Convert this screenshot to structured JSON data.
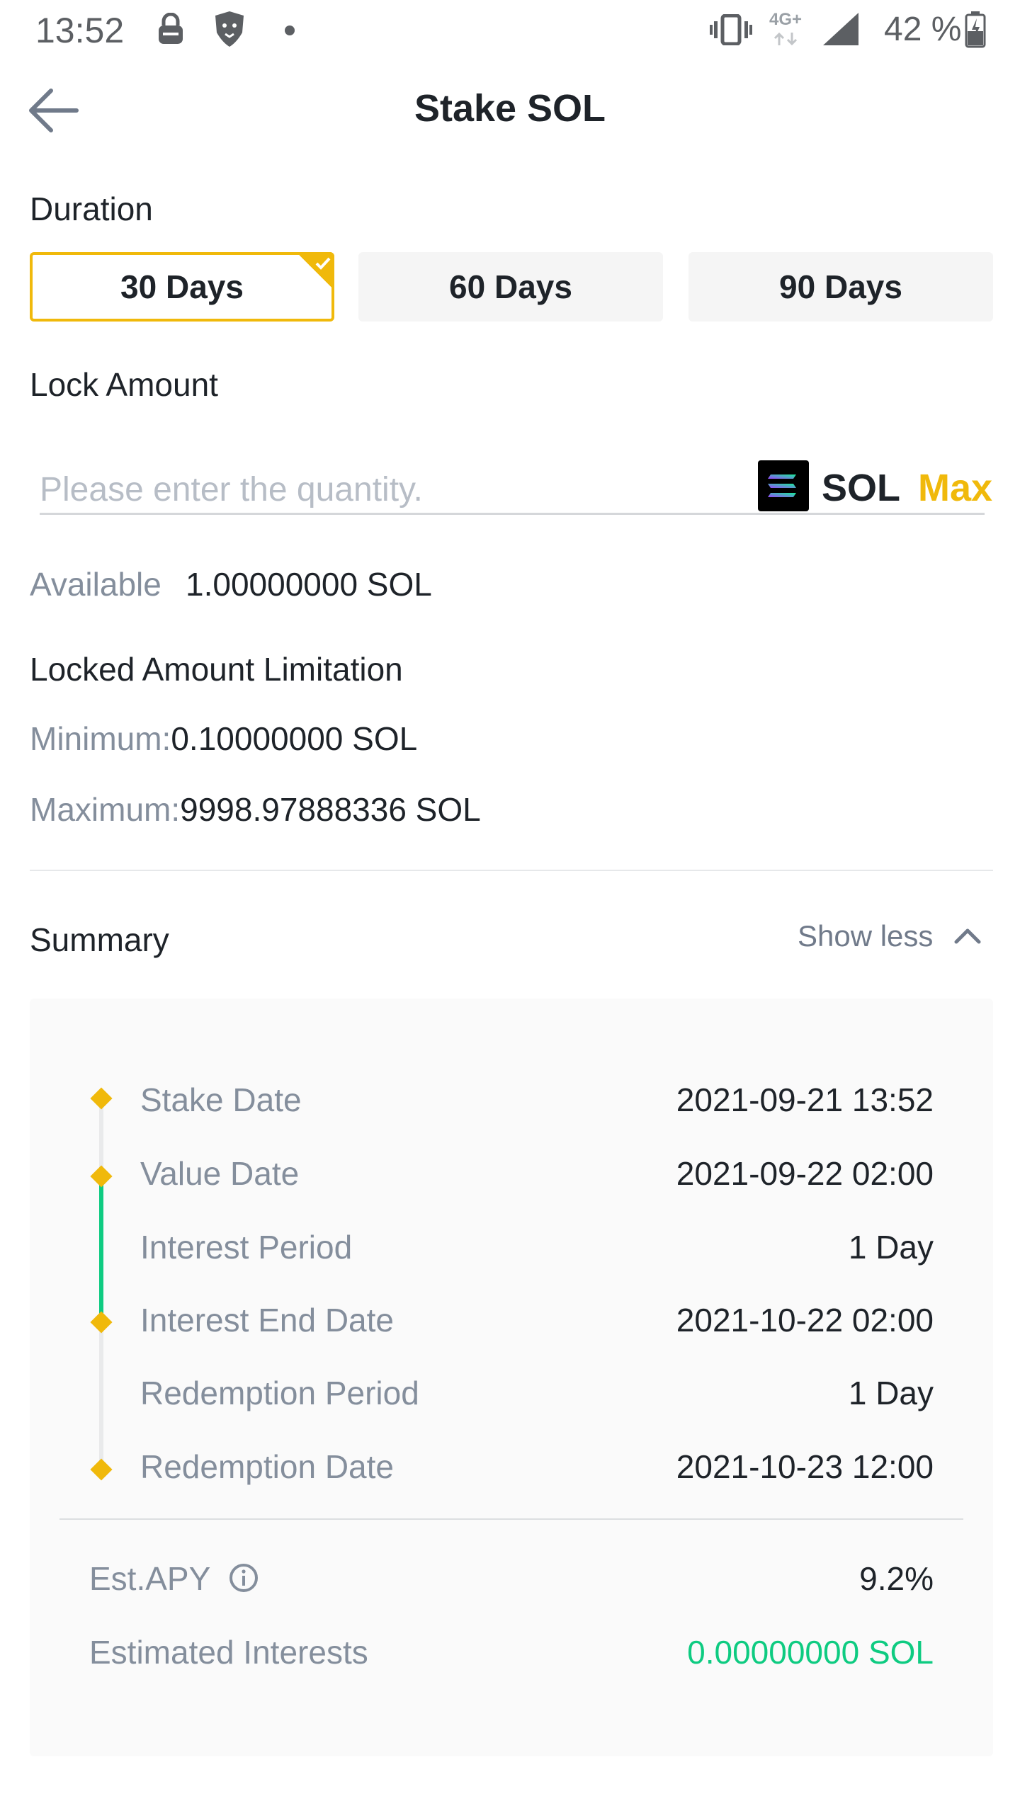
{
  "status_bar": {
    "time": "13:52",
    "network": "4G+",
    "battery": "42 %",
    "icons": [
      "lock-icon",
      "brave-lion-icon",
      "dot-icon",
      "vibrate-icon",
      "signal-icon",
      "battery-icon"
    ]
  },
  "header": {
    "title": "Stake SOL",
    "back_icon": "arrow-left-icon"
  },
  "duration": {
    "label": "Duration",
    "options": [
      {
        "label": "30 Days",
        "selected": true
      },
      {
        "label": "60 Days",
        "selected": false
      },
      {
        "label": "90 Days",
        "selected": false
      }
    ]
  },
  "lock_amount": {
    "label": "Lock Amount",
    "input_placeholder": "Please enter the quantity.",
    "input_value": "",
    "coin": "SOL",
    "max_label": "Max"
  },
  "available": {
    "label": "Available",
    "value": "1.00000000 SOL"
  },
  "limitation": {
    "title": "Locked Amount Limitation",
    "minimum_label": "Minimum:",
    "minimum_value": "0.10000000 SOL",
    "maximum_label": "Maximum:",
    "maximum_value": "9998.97888336 SOL"
  },
  "summary": {
    "title": "Summary",
    "toggle_label": "Show less",
    "timeline": [
      {
        "label": "Stake Date",
        "value": "2021-09-21 13:52"
      },
      {
        "label": "Value Date",
        "value": "2021-09-22 02:00"
      },
      {
        "label": "Interest Period",
        "value": "1 Day"
      },
      {
        "label": "Interest End Date",
        "value": "2021-10-22 02:00"
      },
      {
        "label": "Redemption Period",
        "value": "1 Day"
      },
      {
        "label": "Redemption Date",
        "value": "2021-10-23 12:00"
      }
    ],
    "est_apy_label": "Est.APY",
    "est_apy_value": "9.2%",
    "est_interest_label": "Estimated Interests",
    "est_interest_value": "0.00000000 SOL"
  },
  "colors": {
    "accent": "#f0b90b",
    "positive": "#0ecb81",
    "text": "#1e2329",
    "muted": "#848e9c"
  }
}
